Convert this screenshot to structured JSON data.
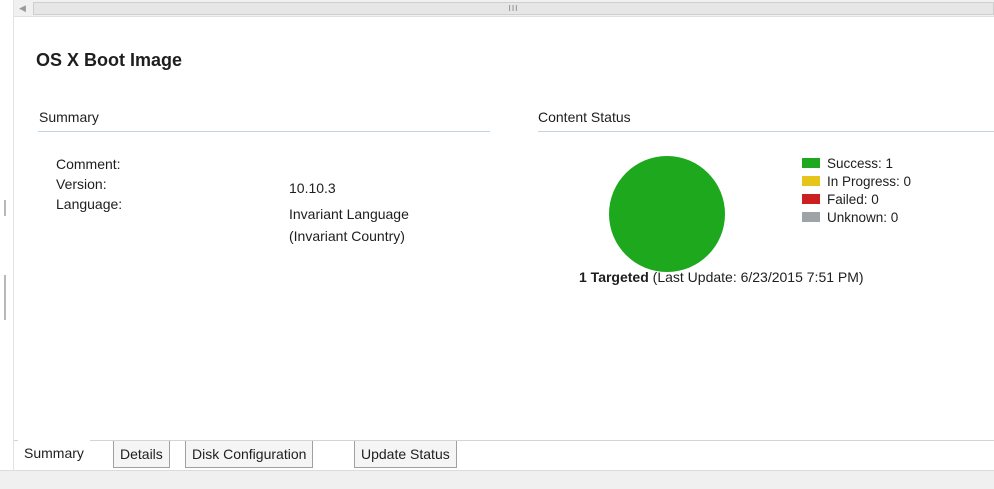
{
  "scrollbar": {
    "grip": "III"
  },
  "page_title": "OS X Boot Image",
  "summary": {
    "title": "Summary",
    "properties": [
      {
        "label": "Comment:",
        "value": ""
      },
      {
        "label": "Version:",
        "value": "10.10.3"
      },
      {
        "label": "Language:",
        "value": "Invariant Language",
        "value_line2": "(Invariant Country)"
      }
    ]
  },
  "content_status": {
    "title": "Content Status",
    "targeted_bold": "1 Targeted",
    "last_update": " (Last Update: 6/23/2015 7:51 PM)",
    "legend": [
      {
        "label": "Success: 1",
        "color": "#1ea81e"
      },
      {
        "label": "In Progress: 0",
        "color": "#e6c41a"
      },
      {
        "label": "Failed: 0",
        "color": "#cc2020"
      },
      {
        "label": "Unknown: 0",
        "color": "#9ea3a8"
      }
    ]
  },
  "chart_data": {
    "type": "pie",
    "categories": [
      "Success",
      "In Progress",
      "Failed",
      "Unknown"
    ],
    "values": [
      1,
      0,
      0,
      0
    ],
    "colors": [
      "#1ea81e",
      "#e6c41a",
      "#cc2020",
      "#9ea3a8"
    ],
    "legend_position": "right"
  },
  "tabs": [
    {
      "label": "Summary",
      "active": true
    },
    {
      "label": "Details",
      "active": false
    },
    {
      "label": "Disk Configuration",
      "active": false
    },
    {
      "label": "Update Status",
      "active": false
    }
  ]
}
